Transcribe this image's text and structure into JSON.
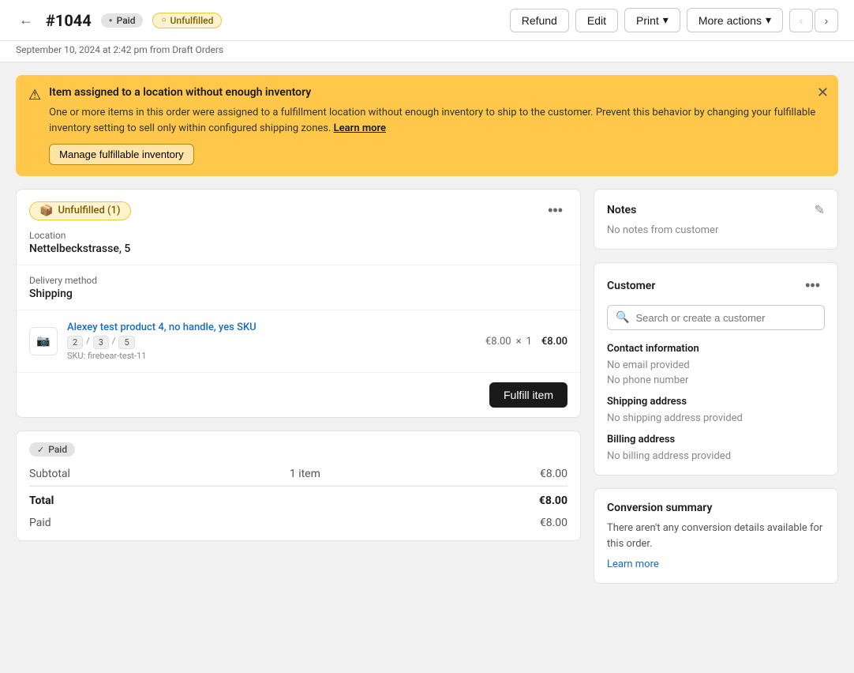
{
  "header": {
    "back_label": "←",
    "order_id": "#1044",
    "badge_paid": "Paid",
    "badge_unfulfilled": "Unfulfilled",
    "subtitle": "September 10, 2024 at 2:42 pm from Draft Orders",
    "btn_refund": "Refund",
    "btn_edit": "Edit",
    "btn_print": "Print",
    "btn_print_arrow": "▾",
    "btn_more_actions": "More actions",
    "btn_more_arrow": "▾",
    "nav_prev": "‹",
    "nav_next": "›"
  },
  "alert": {
    "icon": "⚠",
    "title": "Item assigned to a location without enough inventory",
    "body": "One or more items in this order were assigned to a fulfillment location without enough inventory to ship to the customer. Prevent this behavior by changing your fulfillable inventory setting to sell only within configured shipping zones.",
    "learn_more": "Learn more",
    "manage_btn": "Manage fulfillable inventory",
    "close": "✕"
  },
  "fulfillment_card": {
    "badge_label": "Unfulfilled (1)",
    "location_label": "Location",
    "location_value": "Nettelbeckstrasse, 5",
    "delivery_label": "Delivery method",
    "delivery_value": "Shipping",
    "product_name": "Alexey test product 4, no handle, yes SKU",
    "product_price": "€8.00",
    "product_qty_x": "×",
    "product_qty": "1",
    "product_total": "€8.00",
    "variant_tags": [
      "2",
      "3",
      "5"
    ],
    "sku_label": "SKU: firebear-test-11",
    "fulfill_btn": "Fulfill item",
    "more_dots": "•••"
  },
  "payment_card": {
    "badge_label": "Paid",
    "subtotal_label": "Subtotal",
    "subtotal_items": "1 item",
    "subtotal_value": "€8.00",
    "total_label": "Total",
    "total_value": "€8.00",
    "paid_label": "Paid",
    "paid_value": "€8.00"
  },
  "notes_card": {
    "title": "Notes",
    "body": "No notes from customer",
    "edit_icon": "✎"
  },
  "customer_card": {
    "title": "Customer",
    "more_dots": "•••",
    "search_placeholder": "Search or create a customer",
    "contact_title": "Contact information",
    "email_value": "No email provided",
    "phone_value": "No phone number",
    "shipping_title": "Shipping address",
    "shipping_value": "No shipping address provided",
    "billing_title": "Billing address",
    "billing_value": "No billing address provided"
  },
  "conversion_card": {
    "title": "Conversion summary",
    "body": "There aren't any conversion details available for this order.",
    "learn_more": "Learn more"
  }
}
